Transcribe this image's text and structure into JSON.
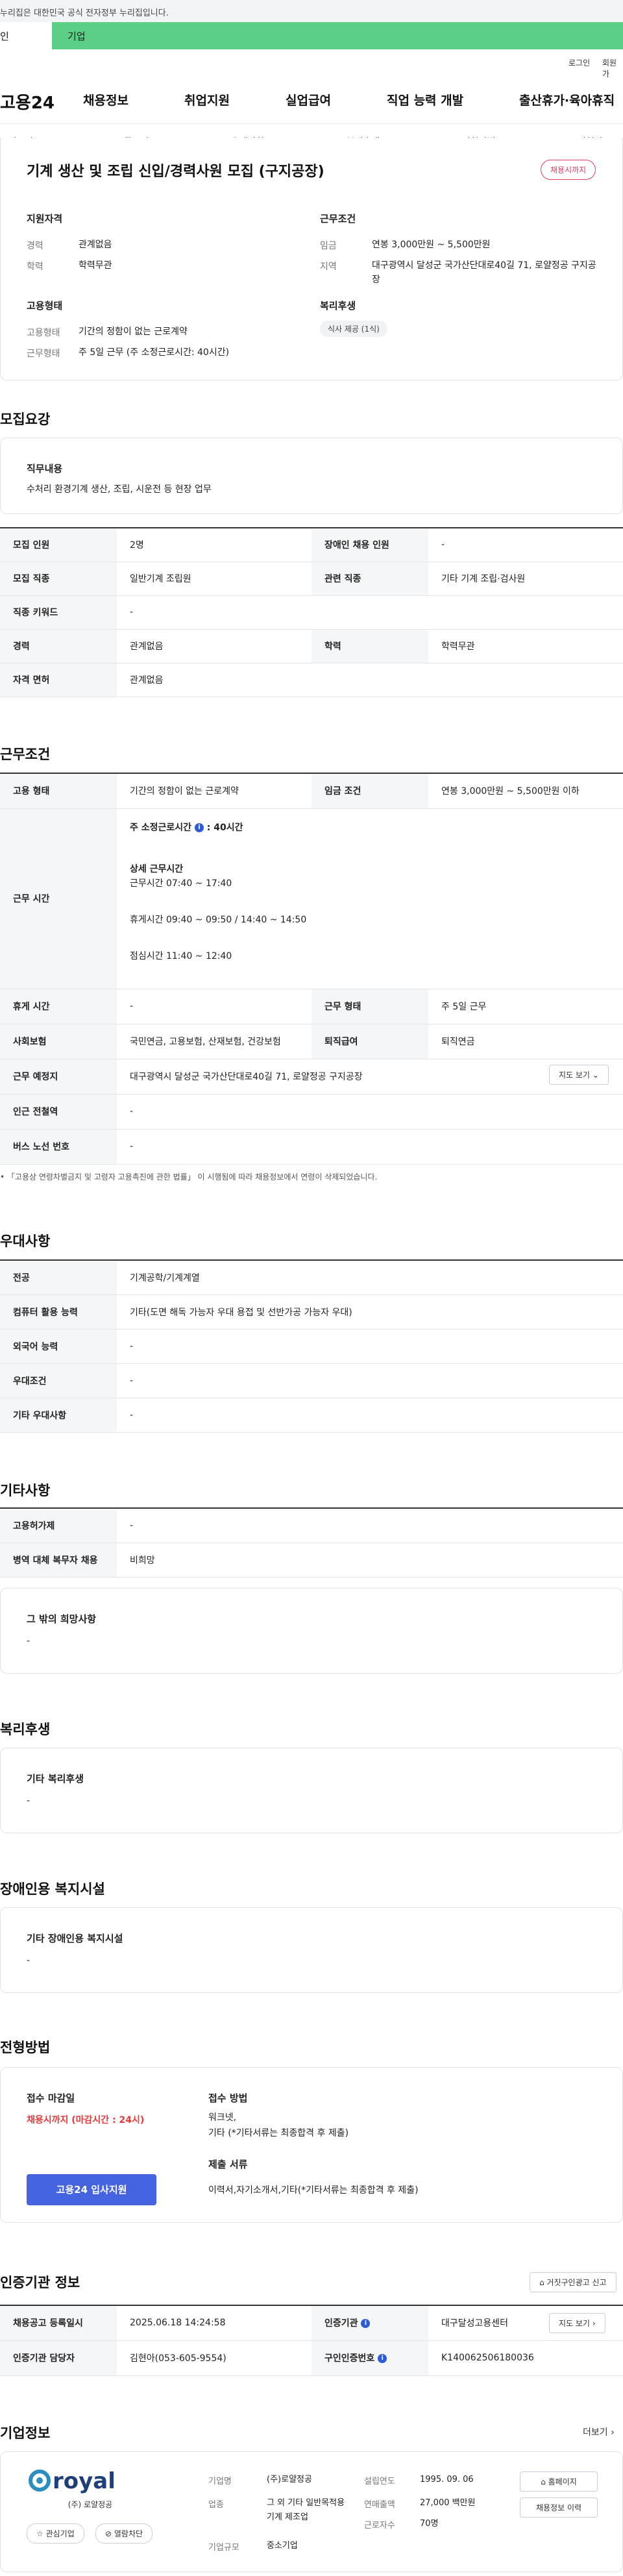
{
  "gov_banner": "누리집은 대한민국 공식 전자정부 누리집입니다.",
  "tabs": {
    "personal": "인",
    "company": "기업"
  },
  "util": {
    "login": "로그인",
    "signup": "회원가"
  },
  "logo_text": "고용24",
  "gnb": [
    "채용정보",
    "취업지원",
    "실업급여",
    "직업 능력 개발",
    "출산휴가·육아휴직"
  ],
  "subnav": [
    "모집요강",
    "근무조건",
    "우대사항",
    "복리후생",
    "전형방법",
    "기업정보"
  ],
  "summary": {
    "title": "기계 생산 및 조립 신입/경력사원 모집 (구지공장)",
    "badge": "채용시까지",
    "qual_heading": "지원자격",
    "exp_label": "경력",
    "exp_value": "관계없음",
    "edu_label": "학력",
    "edu_value": "학력무관",
    "cond_heading": "근무조건",
    "wage_label": "임금",
    "wage_value": "연봉 3,000만원 ~ 5,500만원",
    "area_label": "지역",
    "area_value": "대구광역시 달성군 국가산단대로40길 71, 로얄정공 구지공장",
    "emp_heading": "고용형태",
    "emp_type_label": "고용형태",
    "emp_type_value": "기간의 정함이 없는 근로계약",
    "work_type_label": "근무형태",
    "work_type_value": "주 5일 근무 (주 소정근로시간: 40시간)",
    "welfare_heading": "복리후생",
    "welfare_pill": "식사 제공 (1식)"
  },
  "recruit": {
    "section_title": "모집요강",
    "job_heading": "직무내용",
    "job_content": "수처리 환경기계 생산, 조립, 시운전 등 현장 업무",
    "rows": [
      {
        "k1": "모집 인원",
        "v1": "2명",
        "k2": "장애인 채용 인원",
        "v2": "-"
      },
      {
        "k1": "모집 직종",
        "v1": "일반기계 조립원",
        "k2": "관련 직종",
        "v2": "기타 기계 조립·검사원"
      },
      {
        "k1": "직종 키워드",
        "v1": "-"
      },
      {
        "k1": "경력",
        "v1": "관계없음",
        "k2": "학력",
        "v2": "학력무관"
      },
      {
        "k1": "자격 면허",
        "v1": "관계없음"
      }
    ]
  },
  "work": {
    "section_title": "근무조건",
    "emp_type_k": "고용 형태",
    "emp_type_v": "기간의 정함이 없는 근로계약",
    "wage_k": "임금 조건",
    "wage_v": "연봉 3,000만원 ~ 5,500만원 이하",
    "hours_k": "근무 시간",
    "hours_weekly": "주 소정근로시간",
    "hours_weekly_v": ": 40시간",
    "hours_detail_h": "상세 근무시간",
    "hours_main": "근무시간 07:40 ~ 17:40",
    "hours_break": "휴게시간 09:40 ~ 09:50 / 14:40 ~ 14:50",
    "hours_lunch": "점심시간 11:40 ~ 12:40",
    "rest_k": "휴게 시간",
    "rest_v": "-",
    "shape_k": "근무 형태",
    "shape_v": "주 5일 근무",
    "ins_k": "사회보험",
    "ins_v": "국민연금, 고용보험, 산재보험, 건강보험",
    "sev_k": "퇴직급여",
    "sev_v": "퇴직연금",
    "loc_k": "근무 예정지",
    "loc_v": "대구광역시 달성군 국가산단대로40길 71, 로얄정공 구지공장",
    "map_btn": "지도 보기",
    "station_k": "인근 전철역",
    "station_v": "-",
    "bus_k": "버스 노선 번호",
    "bus_v": "-",
    "note": "「고용상 연령차별금지 및 고령자 고용촉진에 관한 법률」 이 시행됨에 따라 채용정보에서 연령이 삭제되었습니다."
  },
  "pref": {
    "section_title": "우대사항",
    "rows": [
      {
        "k": "전공",
        "v": "기계공학/기계계열"
      },
      {
        "k": "컴퓨터 활용 능력",
        "v": "기타(도면 해독 가능자 우대 용접 및 선반가공 가능자 우대)"
      },
      {
        "k": "외국어 능력",
        "v": "-"
      },
      {
        "k": "우대조건",
        "v": "-"
      },
      {
        "k": "기타 우대사항",
        "v": "-"
      }
    ]
  },
  "etc": {
    "section_title": "기타사항",
    "rows": [
      {
        "k": "고용허가제",
        "v": "-"
      },
      {
        "k": "병역 대체 복무자 채용",
        "v": "비희망"
      }
    ],
    "other_heading": "그 밖의 희망사항",
    "other_value": "-"
  },
  "welfare": {
    "section_title": "복리후생",
    "heading": "기타 복리후생",
    "value": "-"
  },
  "disabled": {
    "section_title": "장애인용 복지시설",
    "heading": "기타 장애인용 복지시설",
    "value": "-"
  },
  "process": {
    "section_title": "전형방법",
    "deadline_h": "접수 마감일",
    "deadline_v": "채용시까지 (마감시간 : 24시)",
    "method_h": "접수 방법",
    "method_v1": "워크넷,",
    "method_v2": "기타 (*기타서류는 최종합격 후 제출)",
    "docs_h": "제출 서류",
    "docs_v": "이력서,자기소개서,기타(*기타서류는 최종합격 후 제출)",
    "apply_btn": "고용24 입사지원"
  },
  "cert": {
    "section_title": "인증기관 정보",
    "report_btn": "거짓구인광고 신고",
    "reg_k": "채용공고 등록일시",
    "reg_v": "2025.06.18 14:24:58",
    "agency_k": "인증기관",
    "agency_v": "대구달성고용센터",
    "map_btn": "지도 보기",
    "manager_k": "인증기관 담당자",
    "manager_v": "김현아(053-605-9554)",
    "num_k": "구인인증번호",
    "num_v": "K140062506180036"
  },
  "company": {
    "section_title": "기업정보",
    "more": "더보기",
    "logo_text": "royal",
    "logo_sub": "(주) 로얄정공",
    "interest_btn": "관심기업",
    "block_btn": "열람차단",
    "name_k": "기업명",
    "name_v": "(주)로얄정공",
    "founded_k": "설립연도",
    "founded_v": "1995. 09. 06",
    "biz_k": "업종",
    "biz_v": "그 외 기타 일반목적용 기계 제조업",
    "sales_k": "연매출액",
    "sales_v": "27,000 백만원",
    "emp_k": "근로자수",
    "emp_v": "70명",
    "size_k": "기업규모",
    "size_v": "중소기업",
    "homepage_btn": "홈페이지",
    "jobs_btn": "채용정보 이력"
  }
}
